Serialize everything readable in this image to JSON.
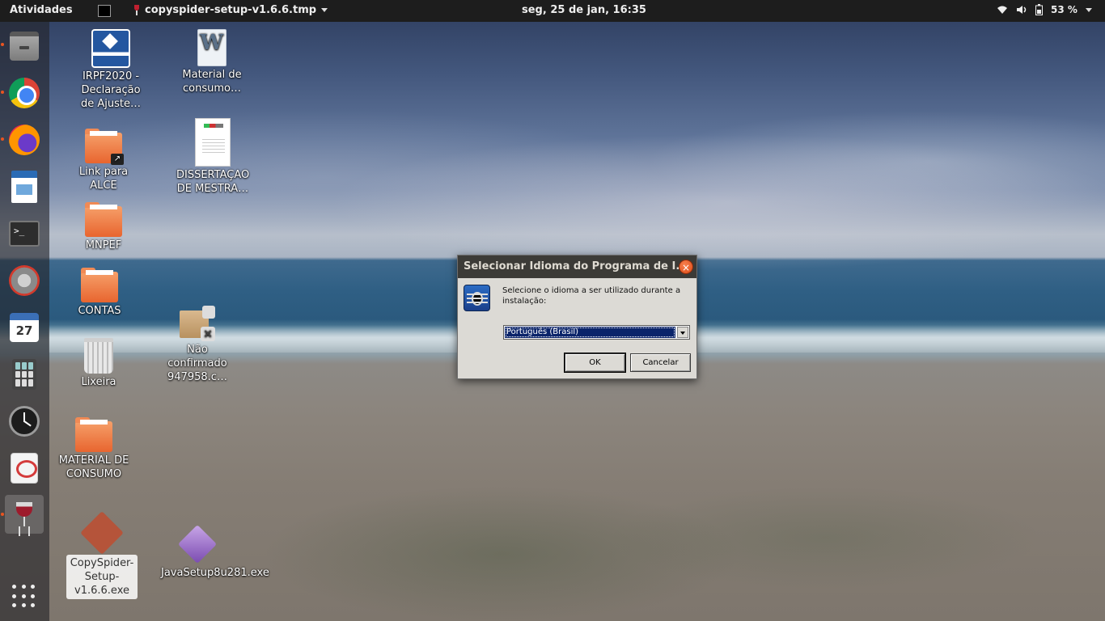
{
  "topbar": {
    "activities": "Atividades",
    "app_name": "copyspider-setup-v1.6.6.tmp",
    "clock": "seg, 25 de jan, 16:35",
    "battery": "53 %"
  },
  "dock": {
    "items": [
      {
        "name": "files",
        "icon": "files-icon"
      },
      {
        "name": "chrome",
        "icon": "chrome-icon"
      },
      {
        "name": "firefox",
        "icon": "firefox-icon"
      },
      {
        "name": "writer",
        "icon": "writer-icon"
      },
      {
        "name": "terminal",
        "icon": "terminal-icon",
        "glyph": ">_"
      },
      {
        "name": "tools",
        "icon": "tools-icon"
      },
      {
        "name": "calendar",
        "icon": "calendar-icon",
        "day": "27"
      },
      {
        "name": "calculator",
        "icon": "calculator-icon"
      },
      {
        "name": "clock",
        "icon": "clock-icon"
      },
      {
        "name": "document-viewer",
        "icon": "document-icon"
      },
      {
        "name": "wine",
        "icon": "wine-icon"
      },
      {
        "name": "show-apps",
        "icon": "apps-grid-icon"
      }
    ]
  },
  "desktop": {
    "icons": [
      {
        "label": "IRPF2020 - Declaração de Ajuste…",
        "icon": "irpf-icon"
      },
      {
        "label": "Material de consumo…",
        "icon": "word-document-icon"
      },
      {
        "label": "Link para ALCE",
        "icon": "folder-link-icon"
      },
      {
        "label": "DISSERTAÇAO DE MESTRA…",
        "icon": "pdf-page-icon"
      },
      {
        "label": "MNPEF",
        "icon": "folder-icon"
      },
      {
        "label": "CONTAS",
        "icon": "folder-icon"
      },
      {
        "label": "Lixeira",
        "icon": "trash-icon"
      },
      {
        "label": "Não confirmado 947958.c…",
        "icon": "package-icon"
      },
      {
        "label": "MATERIAL DE CONSUMO",
        "icon": "folder-icon"
      },
      {
        "label": "CopySpider-Setup-v1.6.6.exe",
        "icon": "wine-exe-icon"
      },
      {
        "label": "JavaSetup8u281.exe",
        "icon": "java-exe-icon"
      }
    ]
  },
  "dialog": {
    "title": "Selecionar Idioma do Programa de I...",
    "prompt": "Selecione o idioma a ser utilizado durante a instalação:",
    "language_selected": "Português (Brasil)",
    "ok_label": "OK",
    "cancel_label": "Cancelar"
  }
}
